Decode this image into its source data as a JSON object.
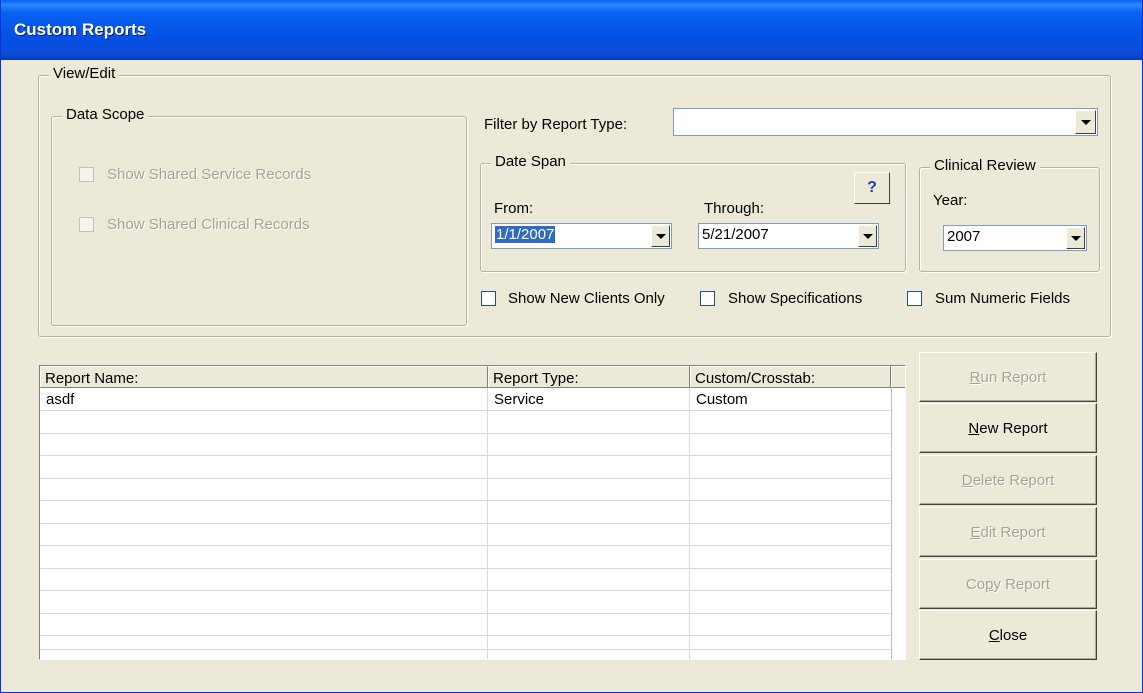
{
  "window": {
    "title": "Custom Reports"
  },
  "view_edit": {
    "legend": "View/Edit"
  },
  "data_scope": {
    "legend": "Data Scope",
    "show_shared_service": "Show Shared Service Records",
    "show_shared_clinical": "Show Shared Clinical Records"
  },
  "filter": {
    "label": "Filter by Report Type:",
    "value": ""
  },
  "date_span": {
    "legend": "Date Span",
    "help": "?",
    "from_label": "From:",
    "from_value": "1/1/2007",
    "through_label": "Through:",
    "through_value": "5/21/2007"
  },
  "clinical_review": {
    "legend": "Clinical Review",
    "year_label": "Year:",
    "year_value": "2007"
  },
  "options": {
    "new_clients_only": "Show New Clients Only",
    "show_specifications": "Show Specifications",
    "sum_numeric_fields": "Sum Numeric Fields"
  },
  "table": {
    "columns": [
      "Report Name:",
      "Report Type:",
      "Custom/Crosstab:"
    ],
    "rows": [
      {
        "name": "asdf",
        "type": "Service",
        "mode": "Custom"
      }
    ]
  },
  "buttons": {
    "run_report": {
      "pre": "",
      "key": "R",
      "post": "un Report"
    },
    "new_report": {
      "pre": "",
      "key": "N",
      "post": "ew Report"
    },
    "delete_report": {
      "pre": "",
      "key": "D",
      "post": "elete Report"
    },
    "edit_report": {
      "pre": "",
      "key": "E",
      "post": "dit Report"
    },
    "copy_report": {
      "pre": "Co",
      "key": "p",
      "post": "y Report"
    },
    "close": {
      "pre": "",
      "key": "C",
      "post": "lose"
    }
  }
}
